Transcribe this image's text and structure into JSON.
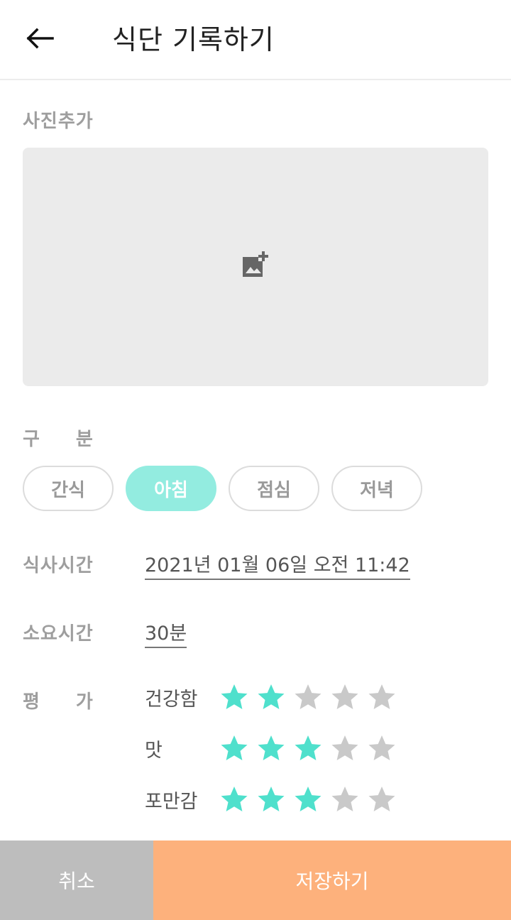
{
  "header": {
    "title": "식단 기록하기",
    "back_icon": "arrow-left-icon"
  },
  "photo": {
    "label": "사진추가",
    "icon": "add-photo-icon"
  },
  "category": {
    "label_1": "구",
    "label_2": "분",
    "options": [
      "간식",
      "아침",
      "점심",
      "저녁"
    ],
    "selected": "아침"
  },
  "meal_time": {
    "label": "식사시간",
    "value": "2021년 01월 06일 오전 11:42"
  },
  "duration": {
    "label": "소요시간",
    "value": "30분"
  },
  "rating": {
    "label_1": "평",
    "label_2": "가",
    "max": 5,
    "items": [
      {
        "label": "건강함",
        "score": 2
      },
      {
        "label": "맛",
        "score": 3
      },
      {
        "label": "포만감",
        "score": 3
      }
    ]
  },
  "actions": {
    "cancel_label": "취소",
    "save_label": "저장하기"
  },
  "colors": {
    "star_filled": "#4fe0cc",
    "star_empty": "#c9c9c9",
    "chip_selected": "#93ece0",
    "cancel_bg": "#bdbdbd",
    "save_bg": "#fdb17c"
  }
}
